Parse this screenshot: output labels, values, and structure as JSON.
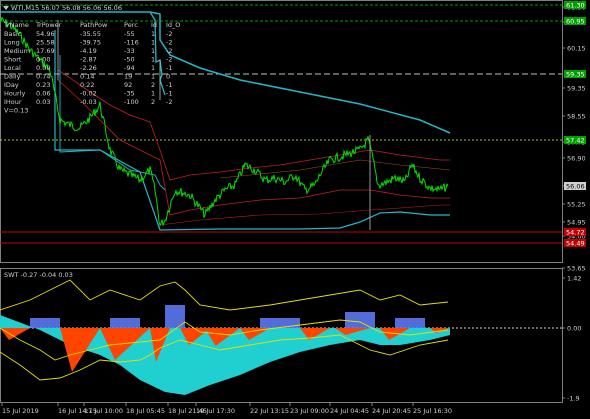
{
  "header": {
    "symbol_line": "WTI,M15  56.07 56.08 56.06 56.06",
    "arrow_icon": "triangle-down-icon"
  },
  "table": {
    "headers": [
      "TrName",
      "TrPower",
      "PathPow",
      "Perc",
      "Id",
      "Id_O"
    ],
    "rows": [
      [
        "Basic",
        "54.96",
        "-35.55",
        "-55",
        "1",
        "-2"
      ],
      [
        "Long",
        "25.58",
        "-39.75",
        "-116",
        "1",
        "-2"
      ],
      [
        "Medium",
        "17.69",
        "-4.19",
        "-33",
        "1",
        "-2"
      ],
      [
        "Short",
        "0.00",
        "-2.87",
        "-50",
        "1",
        "-2"
      ],
      [
        "Local",
        "0.00",
        "-2.26",
        "-94",
        "1",
        "-1"
      ],
      [
        "Daily",
        "0.74",
        "0.14",
        "19",
        "1",
        "0"
      ],
      [
        "IDay",
        "0.23",
        "0.22",
        "92",
        "2",
        "-1"
      ],
      [
        "Hourly",
        "0.06",
        "-0.02",
        "-35",
        "1",
        "-1"
      ],
      [
        "IHour",
        "0.03",
        "-0.03",
        "-100",
        "2",
        "-2"
      ]
    ],
    "footer": "V=0.13"
  },
  "price_axis": {
    "ticks": [
      "61.30",
      "60.95",
      "60.15",
      "59.35",
      "58.55",
      "57.75",
      "56.90",
      "56.06",
      "55.25",
      "54.95",
      "54.00",
      "53.65"
    ],
    "tags": [
      {
        "label": "61.30",
        "color": "#00a000"
      },
      {
        "label": "60.95",
        "color": "#00a000"
      },
      {
        "label": "59.35",
        "color": "#00a000"
      },
      {
        "label": "57.42",
        "color": "#00a000"
      },
      {
        "label": "56.06",
        "color": "#d0d0d0"
      },
      {
        "label": "54.72",
        "color": "#c00000"
      },
      {
        "label": "54.49",
        "color": "#c00000"
      }
    ]
  },
  "indicator": {
    "label": "SWT -0.27 -0.04 0.03",
    "ticks": [
      "1.42",
      "0.00",
      "-1.9"
    ]
  },
  "time_axis": {
    "labels": [
      "15 Jul 2019",
      "16 Jul 14:15",
      "17 Jul 10:00",
      "18 Jul 05:45",
      "18 Jul 21:45",
      "19 Jul 17:30",
      "22 Jul 13:15",
      "23 Jul 09:00",
      "24 Jul 04:45",
      "24 Jul 20:45",
      "25 Jul 16:30"
    ]
  },
  "colors": {
    "price": "#00e000",
    "envelope_teal": "#20b8c8",
    "envelope_red": "#c02020",
    "indicator_yellow": "#e0e000",
    "indicator_orange": "#ff4400",
    "indicator_cyan": "#20d0d0",
    "indicator_blue": "#6080ff"
  }
}
